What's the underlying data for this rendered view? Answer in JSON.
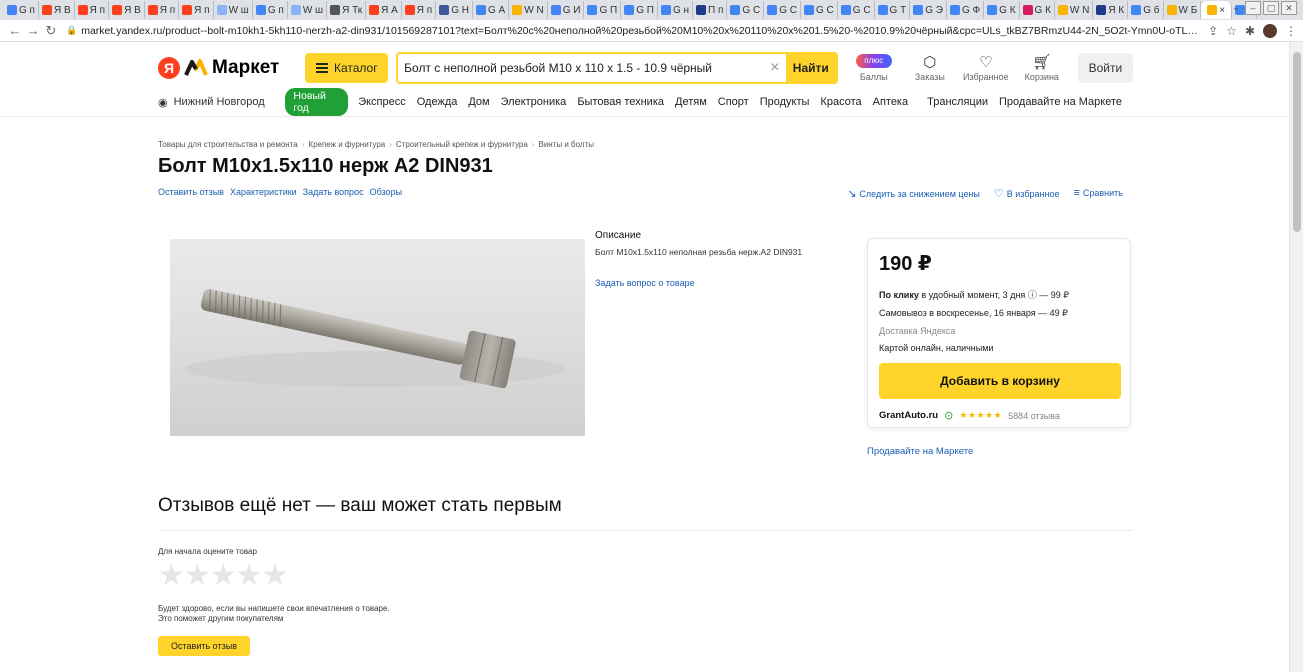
{
  "browser": {
    "tabs": [
      "G п",
      "Я В",
      "Я п",
      "Я В",
      "Я п",
      "Я п",
      "W ш",
      "G п",
      "W ш",
      "Я Тк",
      "Я А",
      "Я п",
      "G Н",
      "G А",
      "W N",
      "G И",
      "G П",
      "G П",
      "G н",
      "П п",
      "G С",
      "G С",
      "G С",
      "G С",
      "G Т",
      "G Э",
      "G Ф",
      "G К",
      "G К",
      "W N",
      "Я К",
      "G б",
      "W Б"
    ],
    "active_tab_label": "×",
    "last_tab": "2",
    "new_tab": "+",
    "url": "market.yandex.ru/product--bolt-m10kh1-5kh110-nerzh-a2-din931/101569287101?text=Болт%20с%20неполной%20резьбой%20M10%20x%20110%20x%201.5%20-%2010.9%20чёрный&cpc=ULs_tkBZ7BRmzU44-2N_5O2t-Ymn0U-oTL7TVTxzwLOpsZ1E0FU..."
  },
  "header": {
    "logo_text": "Маркет",
    "catalog_label": "Каталог",
    "search_value": "Болт с неполной резьбой M10 x 110 x 1.5 - 10.9 чёрный",
    "find_label": "Найти",
    "plus_badge": "плюс",
    "points_label": "Баллы",
    "orders_label": "Заказы",
    "favorites_label": "Избранное",
    "cart_label": "Корзина",
    "login_label": "Войти"
  },
  "nav": {
    "city": "Нижний Новгород",
    "new_year": "Новый год",
    "items": [
      "Экспресс",
      "Одежда",
      "Дом",
      "Электроника",
      "Бытовая техника",
      "Детям",
      "Спорт",
      "Продукты",
      "Красота",
      "Аптека"
    ],
    "translations": "Трансляции",
    "sell": "Продавайте на Маркете"
  },
  "breadcrumbs": [
    "Товары для строительства и ремонта",
    "Крепеж и фурнитура",
    "Строительный крепеж и фурнитура",
    "Винты и болты"
  ],
  "product": {
    "title": "Болт М10х1.5х110 нерж А2 DIN931",
    "links": [
      "Оставить отзыв",
      "Характеристики",
      "Задать вопрос",
      "Обзоры"
    ],
    "track_price": "Следить за снижением цены",
    "to_favorites": "В избранное",
    "compare": "Сравнить",
    "desc_heading": "Описание",
    "desc_text": "Болт М10х1.5х110 неполная резьба нерж.А2 DIN931",
    "ask_link": "Задать вопрос о товаре"
  },
  "offer": {
    "price": "190 ₽",
    "delivery1_bold": "По клику",
    "delivery1_rest": " в удобный момент, 3 дня ⓘ — 99 ₽",
    "delivery2": "Самовывоз в воскресенье, 16 января — 49 ₽",
    "delivery_by": "Доставка Яндекса",
    "payment": "Картой онлайн, наличными",
    "add_to_cart": "Добавить в корзину",
    "seller": "GrantAuto.ru",
    "stars": "★★★★★",
    "reviews": "5884 отзыва"
  },
  "sell_link": "Продавайте на Маркете",
  "reviews_section": {
    "title": "Отзывов ещё нет — ваш может стать первым",
    "rate_label": "Для начала оцените товар",
    "stars": "★★★★★",
    "hint1": "Будет здорово, если вы напишете свои впечатления о товаре.",
    "hint2": "Это поможет другим покупателям",
    "leave_button": "Оставить отзыв"
  },
  "colors": {
    "accent_yellow": "#fed42b",
    "link_blue": "#1a5fb4",
    "green": "#21a038",
    "yandex_red": "#fc3f1d"
  }
}
